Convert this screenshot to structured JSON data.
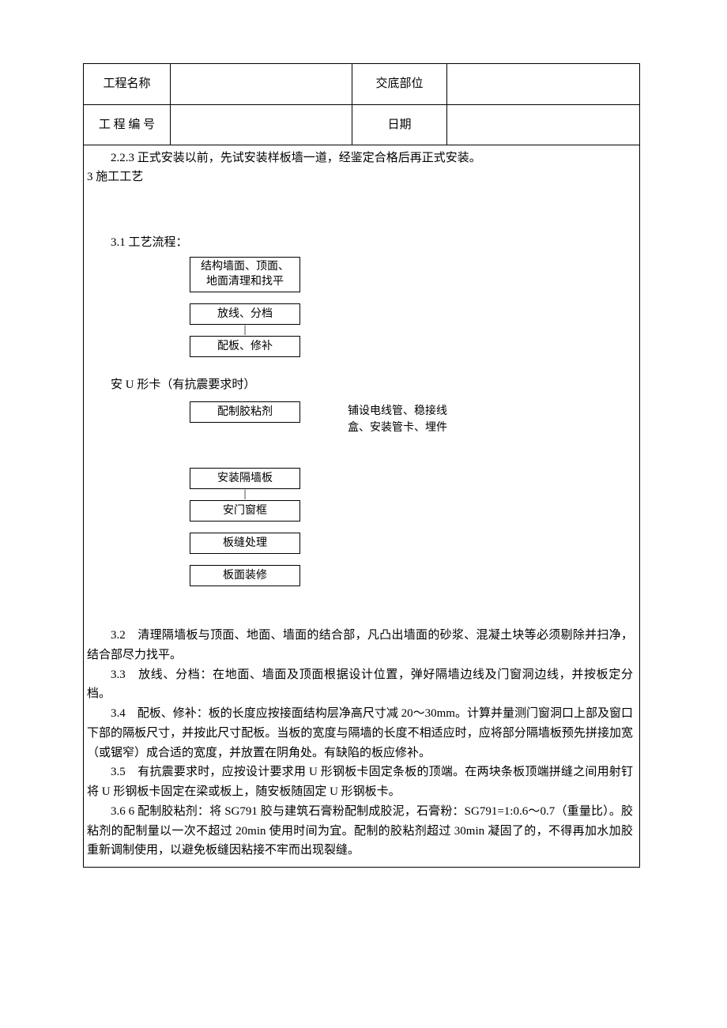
{
  "header": {
    "proj_name_label": "工程名称",
    "proj_name_value": "",
    "disclosure_label": "交底部位",
    "disclosure_value": "",
    "proj_no_label": "工 程 编 号",
    "proj_no_value": "",
    "date_label": "日期",
    "date_value": ""
  },
  "intro": {
    "line1": "2.2.3 正式安装以前，先试安装样板墙一道，经鉴定合格后再正式安装。",
    "line2": "3 施工工艺"
  },
  "flow": {
    "title": "3.1 工艺流程：",
    "step1a": "结构墙面、顶面、",
    "step1b": "地面清理和找平",
    "step2": "放线、分档",
    "step3": "配板、修补",
    "wide": "安 U 形卡（有抗震要求时）",
    "step4": "配制胶粘剂",
    "side4a": "铺设电线管、稳接线",
    "side4b": "盒、安装管卡、埋件",
    "step5": "安装隔墙板",
    "step6": "安门窗框",
    "step7": "板缝处理",
    "step8": "板面装修",
    "conn": "|"
  },
  "body": {
    "p32": "3.2　清理隔墙板与顶面、地面、墙面的结合部，凡凸出墙面的砂浆、混凝土块等必须剔除并扫净，结合部尽力找平。",
    "p33": "3.3　放线、分档：在地面、墙面及顶面根据设计位置，弹好隔墙边线及门窗洞边线，并按板定分档。",
    "p34": "3.4　配板、修补：板的长度应按接面结构层净高尺寸减 20～30mm。计算并量测门窗洞口上部及窗口下部的隔板尺寸，并按此尺寸配板。当板的宽度与隔墙的长度不相适应时，应将部分隔墙板预先拼接加宽（或锯窄）成合适的宽度，并放置在阴角处。有缺陷的板应修补。",
    "p35": "3.5　有抗震要求时，应按设计要求用 U 形钢板卡固定条板的顶端。在两块条板顶端拼缝之间用射钉将 U 形钢板卡固定在梁或板上，随安板随固定 U 形钢板卡。",
    "p36": "3.6  6 配制胶粘剂：将 SG791 胶与建筑石膏粉配制成胶泥，石膏粉：SG791=1:0.6～0.7（重量比）。胶粘剂的配制量以一次不超过 20min 使用时间为宜。配制的胶粘剂超过 30min 凝固了的，不得再加水加胶重新调制使用，以避免板缝因粘接不牢而出现裂缝。"
  }
}
